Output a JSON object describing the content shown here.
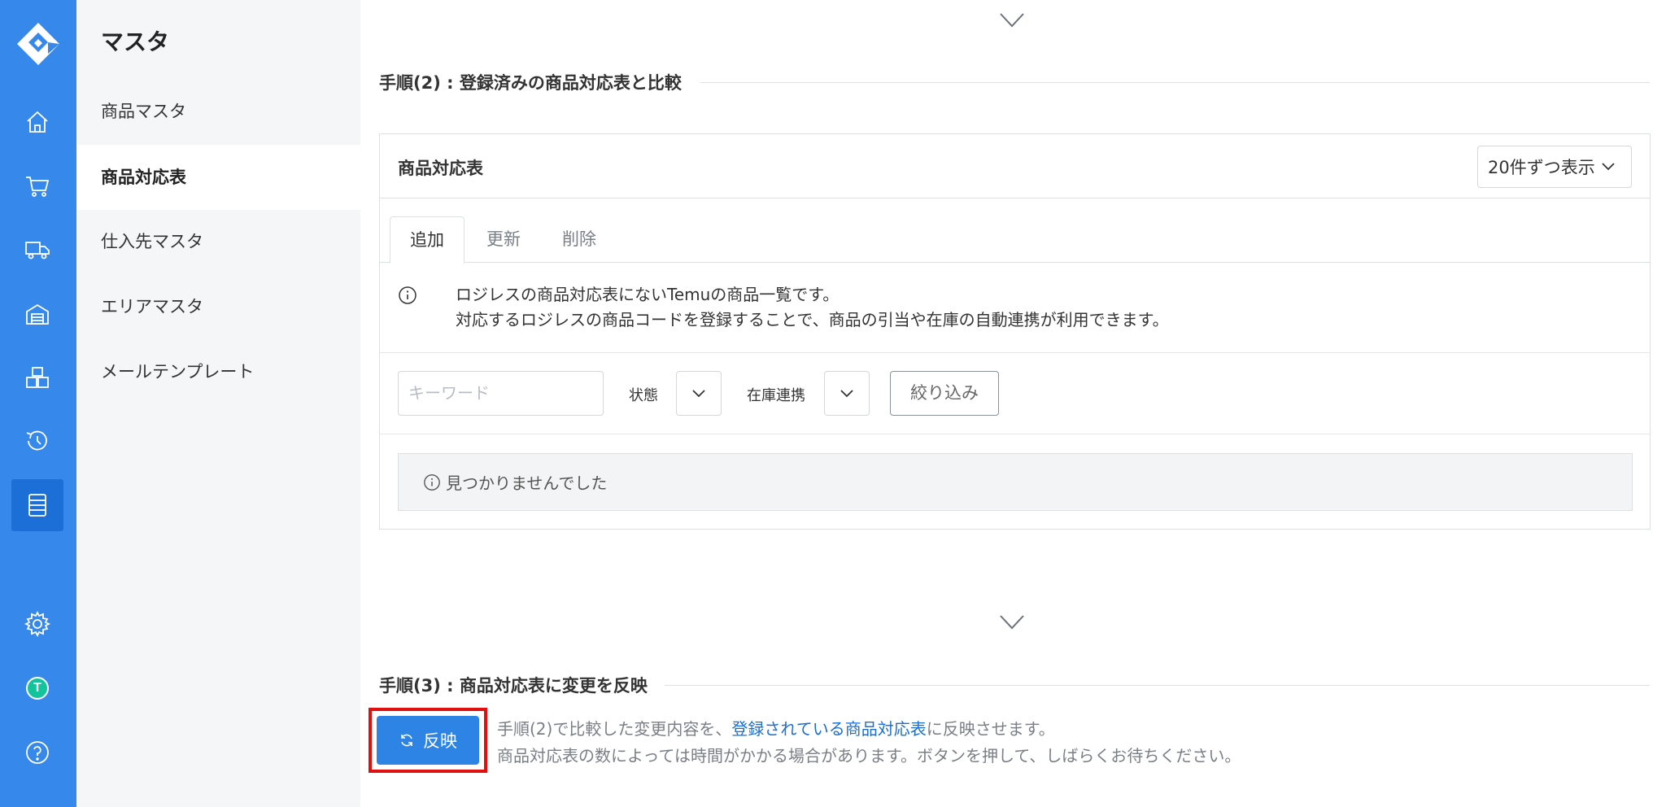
{
  "sidebar": {
    "title": "マスタ",
    "items": [
      {
        "label": "商品マスタ"
      },
      {
        "label": "商品対応表"
      },
      {
        "label": "仕入先マスタ"
      },
      {
        "label": "エリアマスタ"
      },
      {
        "label": "メールテンプレート"
      }
    ]
  },
  "rail": {
    "avatar_letter": "T",
    "icons": [
      "home-icon",
      "cart-icon",
      "truck-icon",
      "warehouse-icon",
      "boxes-icon",
      "history-icon",
      "list-icon",
      "gear-icon",
      "help-icon"
    ],
    "accent": "#3689eb"
  },
  "step2": {
    "title": "手順(2) : 登録済みの商品対応表と比較",
    "panel_title": "商品対応表",
    "per_page": "20件ずつ表示",
    "tabs": [
      {
        "label": "追加"
      },
      {
        "label": "更新"
      },
      {
        "label": "削除"
      }
    ],
    "info_line1": "ロジレスの商品対応表にないTemuの商品一覧です。",
    "info_line2": "対応するロジレスの商品コードを登録することで、商品の引当や在庫の自動連携が利用できます。",
    "keyword_placeholder": "キーワード",
    "status_label": "状態",
    "stock_label": "在庫連携",
    "filter_button": "絞り込み",
    "empty_text": "見つかりませんでした"
  },
  "step3": {
    "title": "手順(3) : 商品対応表に変更を反映",
    "button_label": "反映",
    "desc_before": "手順(2)で比較した変更内容を、",
    "desc_link": "登録されている商品対応表",
    "desc_after": "に反映させます。",
    "desc_line2": "商品対応表の数によっては時間がかかる場合があります。ボタンを押して、しばらくお待ちください。"
  }
}
